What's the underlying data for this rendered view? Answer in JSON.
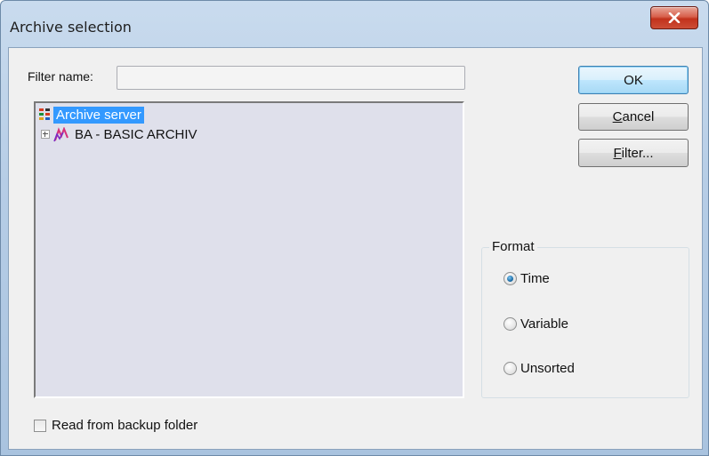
{
  "window": {
    "title": "Archive selection",
    "close_glyph": "X"
  },
  "filter": {
    "label": "Filter name:",
    "value": "",
    "placeholder": ""
  },
  "tree": {
    "root_label": "Archive server",
    "root_icon": "archive-server-icon",
    "children": [
      {
        "label": "BA - BASIC ARCHIV",
        "icon": "archive-icon",
        "expander": "plus"
      }
    ]
  },
  "buttons": {
    "ok": {
      "label": "OK"
    },
    "cancel": {
      "pre": "",
      "accel": "C",
      "rest": "ancel"
    },
    "filter": {
      "pre": "",
      "accel": "F",
      "rest": "ilter..."
    }
  },
  "format": {
    "legend": "Format",
    "options": [
      {
        "label": "Time",
        "checked": true
      },
      {
        "label": "Variable",
        "checked": false
      },
      {
        "label": "Unsorted",
        "checked": false
      }
    ]
  },
  "backup": {
    "label": "Read from backup folder",
    "checked": false
  },
  "colors": {
    "selection": "#3399ff",
    "tree_background": "#dfe0eb",
    "dialog_background": "#f0f0f0",
    "close_button": "#c2321c"
  }
}
